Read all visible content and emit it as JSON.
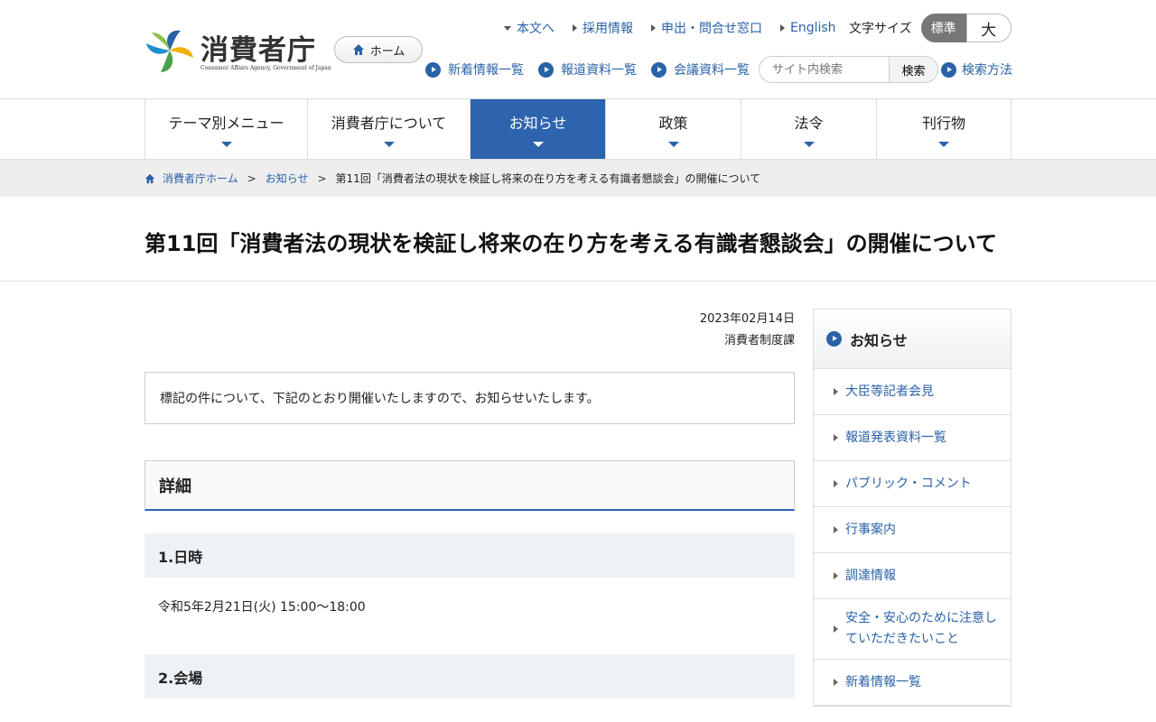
{
  "header": {
    "logo_title": "消費者庁",
    "logo_subtitle": "Consumer Affairs Agency, Government of Japan",
    "home_label": "ホーム",
    "top_links": [
      "本文へ",
      "採用情報",
      "申出・問合せ窓口",
      "English"
    ],
    "font_size_label": "文字サイズ",
    "font_size_standard": "標準",
    "font_size_large": "大",
    "sub_links": [
      "新着情報一覧",
      "報道資料一覧",
      "会議資料一覧"
    ],
    "search_placeholder": "サイト内検索",
    "search_button": "検索",
    "search_help": "検索方法"
  },
  "nav": {
    "items": [
      "テーマ別メニュー",
      "消費者庁について",
      "お知らせ",
      "政策",
      "法令",
      "刊行物"
    ],
    "active": "お知らせ"
  },
  "breadcrumb": {
    "items": [
      "消費者庁ホーム",
      "お知らせ",
      "第11回「消費者法の現状を検証し将来の在り方を考える有識者懇談会」の開催について"
    ]
  },
  "page": {
    "title": "第11回「消費者法の現状を検証し将来の在り方を考える有識者懇談会」の開催について",
    "date": "2023年02月14日",
    "department": "消費者制度課",
    "intro": "標記の件について、下記のとおり開催いたしますので、お知らせいたします。",
    "detail_heading": "詳細",
    "sections": [
      {
        "heading": "1.日時",
        "body": "令和5年2月21日(火) 15:00～18:00"
      },
      {
        "heading": "2.会場",
        "body": ""
      }
    ]
  },
  "sidebar": {
    "heading": "お知らせ",
    "items": [
      "大臣等記者会見",
      "報道発表資料一覧",
      "パブリック・コメント",
      "行事案内",
      "調達情報",
      "安全・安心のために注意していただきたいこと",
      "新着情報一覧"
    ]
  },
  "colors": {
    "accent": "#2d64ad",
    "link": "#2a62a8"
  }
}
